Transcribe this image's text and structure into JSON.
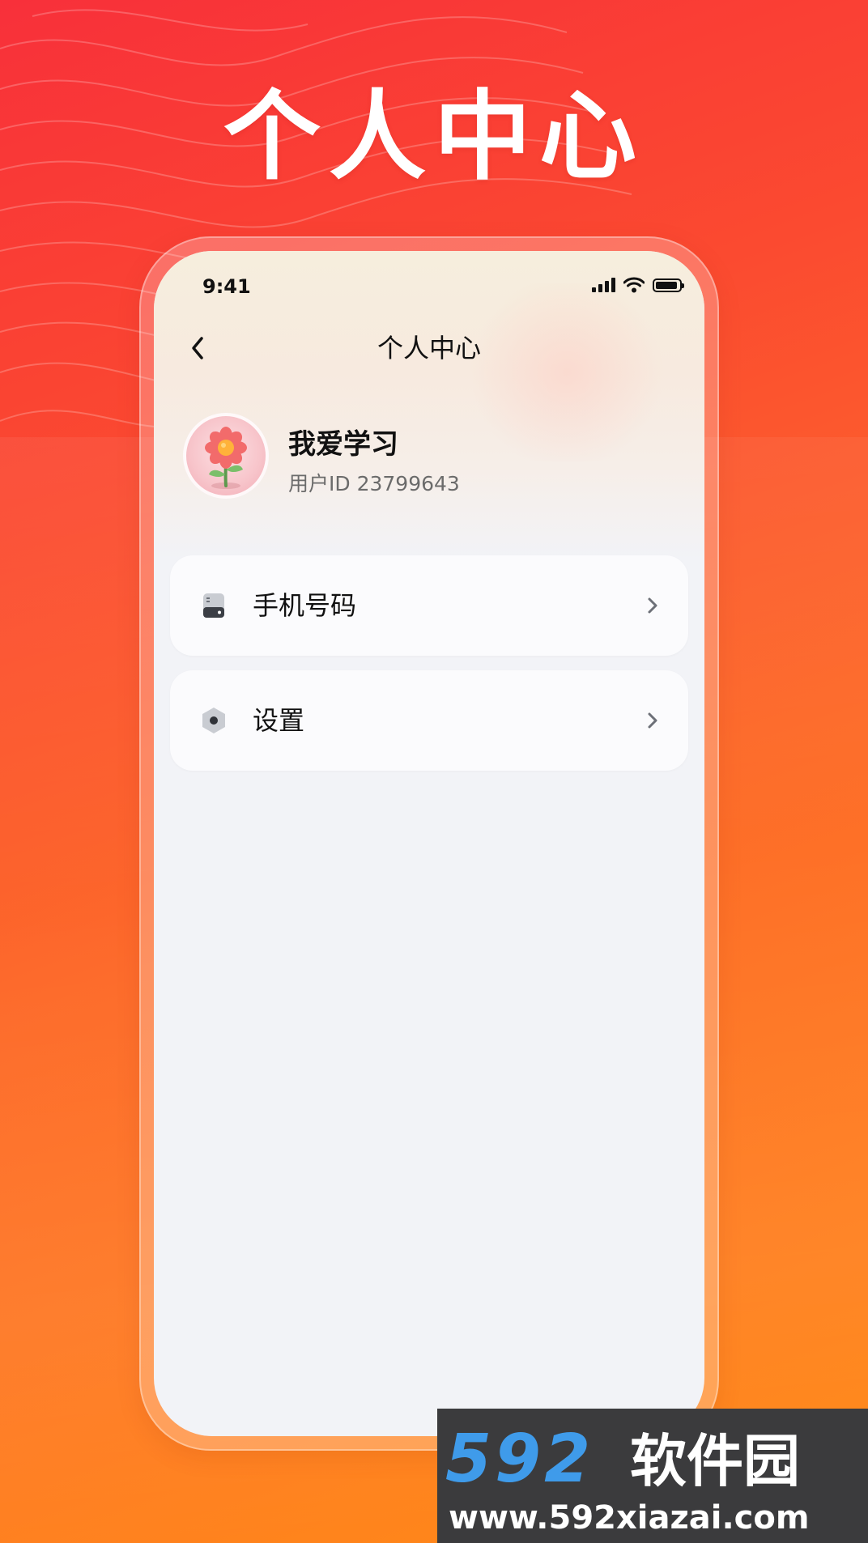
{
  "poster": {
    "title": "个人中心"
  },
  "status_bar": {
    "time": "9:41",
    "icons": [
      "signal-icon",
      "wifi-icon",
      "battery-icon"
    ]
  },
  "nav": {
    "back_icon": "chevron-left-icon",
    "title": "个人中心"
  },
  "profile": {
    "avatar_icon": "flower-avatar",
    "name": "我爱学习",
    "user_id": "用户ID 23799643"
  },
  "menu": {
    "items": [
      {
        "icon": "phone-card-icon",
        "label": "手机号码"
      },
      {
        "icon": "hexagon-settings-icon",
        "label": "设置"
      }
    ]
  },
  "watermark": {
    "brand_number": "592",
    "brand_name": "软件园",
    "url": "www.592xiazai.com"
  },
  "colors": {
    "background_top": "#f8303a",
    "background_bottom": "#ff8a14",
    "screen_background": "#f2f3f7",
    "card_background": "#fbfbfd",
    "watermark_background": "#3b3b3d",
    "watermark_accent": "#3f9bea"
  }
}
